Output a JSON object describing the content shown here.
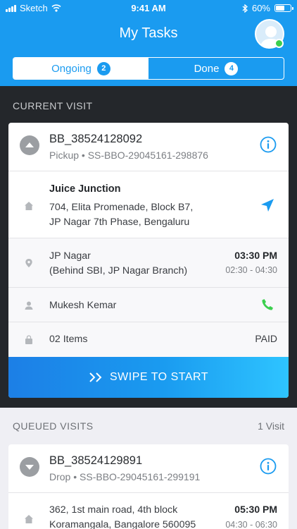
{
  "status_bar": {
    "carrier": "Sketch",
    "time": "9:41 AM",
    "battery": "60%"
  },
  "header": {
    "title": "My Tasks"
  },
  "tabs": [
    {
      "label": "Ongoing",
      "count": "2"
    },
    {
      "label": "Done",
      "count": "4"
    }
  ],
  "current": {
    "section_title": "CURRENT VISIT",
    "id": "BB_38524128092",
    "type": "Pickup",
    "ref": "SS-BBO-29045161-298876",
    "shop_name": "Juice Junction",
    "address_line1": "704, Elita Promenade, Block B7,",
    "address_line2": "JP Nagar 7th Phase, Bengaluru",
    "location_line1": "JP Nagar",
    "location_line2": "(Behind SBI, JP Nagar Branch)",
    "time": "03:30 PM",
    "time_window": "02:30 - 04:30",
    "contact": "Mukesh Kemar",
    "items": "02 Items",
    "payment": "PAID",
    "swipe_label": "SWIPE TO START"
  },
  "queued": {
    "section_title": "QUEUED VISITS",
    "count_label": "1 Visit",
    "id": "BB_38524129891",
    "type": "Drop",
    "ref": "SS-BBO-29045161-299191",
    "address_line1": "362, 1st main road, 4th block",
    "address_line2": "Koramangala, Bangalore 560095",
    "time": "05:30 PM",
    "time_window": "04:30 - 06:30"
  },
  "colors": {
    "primary": "#1a9bf0",
    "dark": "#24272b",
    "green": "#3ccf4e"
  },
  "icons": [
    "signal-icon",
    "wifi-icon",
    "bluetooth-icon",
    "battery-icon",
    "avatar",
    "collapse-icon",
    "expand-icon",
    "info-icon",
    "home-icon",
    "navigate-icon",
    "pin-icon",
    "person-icon",
    "phone-icon",
    "bag-icon",
    "chevrons-right-icon"
  ]
}
